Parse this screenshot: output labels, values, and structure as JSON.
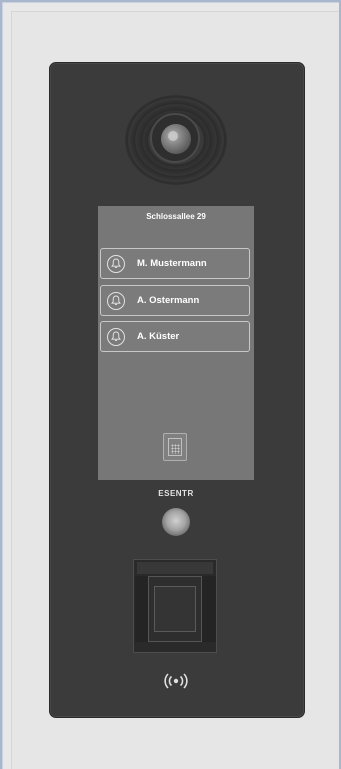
{
  "screen": {
    "address": "Schlossallee 29",
    "residents": [
      {
        "name": "M. Mustermann",
        "icon": "bell-icon"
      },
      {
        "name": "A. Ostermann",
        "icon": "bell-icon"
      },
      {
        "name": "A. Küster",
        "icon": "bell-icon"
      }
    ],
    "keypad_icon": "keypad-icon"
  },
  "device": {
    "brand": "ESENTR",
    "nfc_icon": "nfc-icon",
    "colors": {
      "panel": "#3b3b3b",
      "screen": "#777777",
      "text": "#ffffff"
    }
  }
}
